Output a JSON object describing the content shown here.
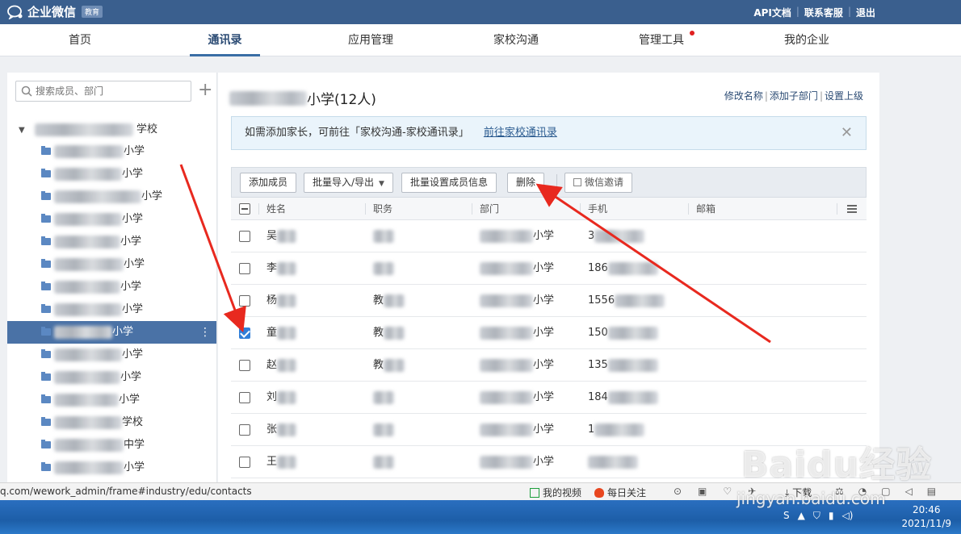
{
  "app": {
    "name": "企业微信",
    "badge": "教育"
  },
  "top_links": [
    "API文档",
    "联系客服",
    "退出"
  ],
  "nav": [
    {
      "label": "首页",
      "active": false
    },
    {
      "label": "通讯录",
      "active": true
    },
    {
      "label": "应用管理",
      "active": false
    },
    {
      "label": "家校沟通",
      "active": false
    },
    {
      "label": "管理工具",
      "active": false,
      "dot": true
    },
    {
      "label": "我的企业",
      "active": false
    }
  ],
  "sidebar": {
    "search_placeholder": "搜索成员、部门",
    "add_icon": "plus-icon",
    "root_suffix": "学校",
    "items": [
      {
        "suffix": "小学"
      },
      {
        "suffix": "小学"
      },
      {
        "suffix": "小学"
      },
      {
        "suffix": "小学"
      },
      {
        "suffix": "小学"
      },
      {
        "suffix": "小学"
      },
      {
        "suffix": "小学"
      },
      {
        "suffix": "小学"
      },
      {
        "suffix": "小学",
        "selected": true
      },
      {
        "suffix": "小学"
      },
      {
        "suffix": "小学"
      },
      {
        "suffix": "小学"
      },
      {
        "suffix": "学校"
      },
      {
        "suffix": "中学"
      },
      {
        "suffix": "小学"
      }
    ]
  },
  "main": {
    "title_suffix": "小学(12人)",
    "actions": [
      "修改名称",
      "添加子部门",
      "设置上级"
    ],
    "notice": {
      "text": "如需添加家长，可前往「家校沟通-家校通讯录」",
      "link": "前往家校通讯录"
    },
    "toolbar": {
      "add_member": "添加成员",
      "batch_import": "批量导入/导出",
      "batch_set": "批量设置成员信息",
      "delete": "删除",
      "invite": "微信邀请"
    },
    "columns": [
      "姓名",
      "职务",
      "部门",
      "手机",
      "邮箱"
    ],
    "rows": [
      {
        "name": "吴",
        "title": "",
        "dept": "小学",
        "phone": "3",
        "checked": false
      },
      {
        "name": "李",
        "title": "",
        "dept": "小学",
        "phone": "186",
        "checked": false
      },
      {
        "name": "杨",
        "title": "教",
        "dept": "小学",
        "phone": "1556",
        "checked": false
      },
      {
        "name": "童",
        "title": "教",
        "dept": "小学",
        "phone": "150",
        "checked": true
      },
      {
        "name": "赵",
        "title": "教",
        "dept": "小学",
        "phone": "135",
        "checked": false
      },
      {
        "name": "刘",
        "title": "",
        "dept": "小学",
        "phone": "184",
        "checked": false
      },
      {
        "name": "张",
        "title": "",
        "dept": "小学",
        "phone": "1",
        "checked": false
      },
      {
        "name": "王",
        "title": "",
        "dept": "小学",
        "phone": "",
        "checked": false
      }
    ]
  },
  "statusbar": {
    "url": "q.com/wework_admin/frame#industry/edu/contacts",
    "items": [
      "我的视频",
      "每日关注",
      "下载"
    ]
  },
  "taskbar": {
    "time": "20:46",
    "date": "2021/11/9"
  },
  "watermark": {
    "main": "Baidu经验",
    "sub": "jingyan.baidu.com"
  },
  "colors": {
    "topbar": "#3a5f8e",
    "selected": "#4a72a6",
    "arrow": "#e8291f"
  }
}
